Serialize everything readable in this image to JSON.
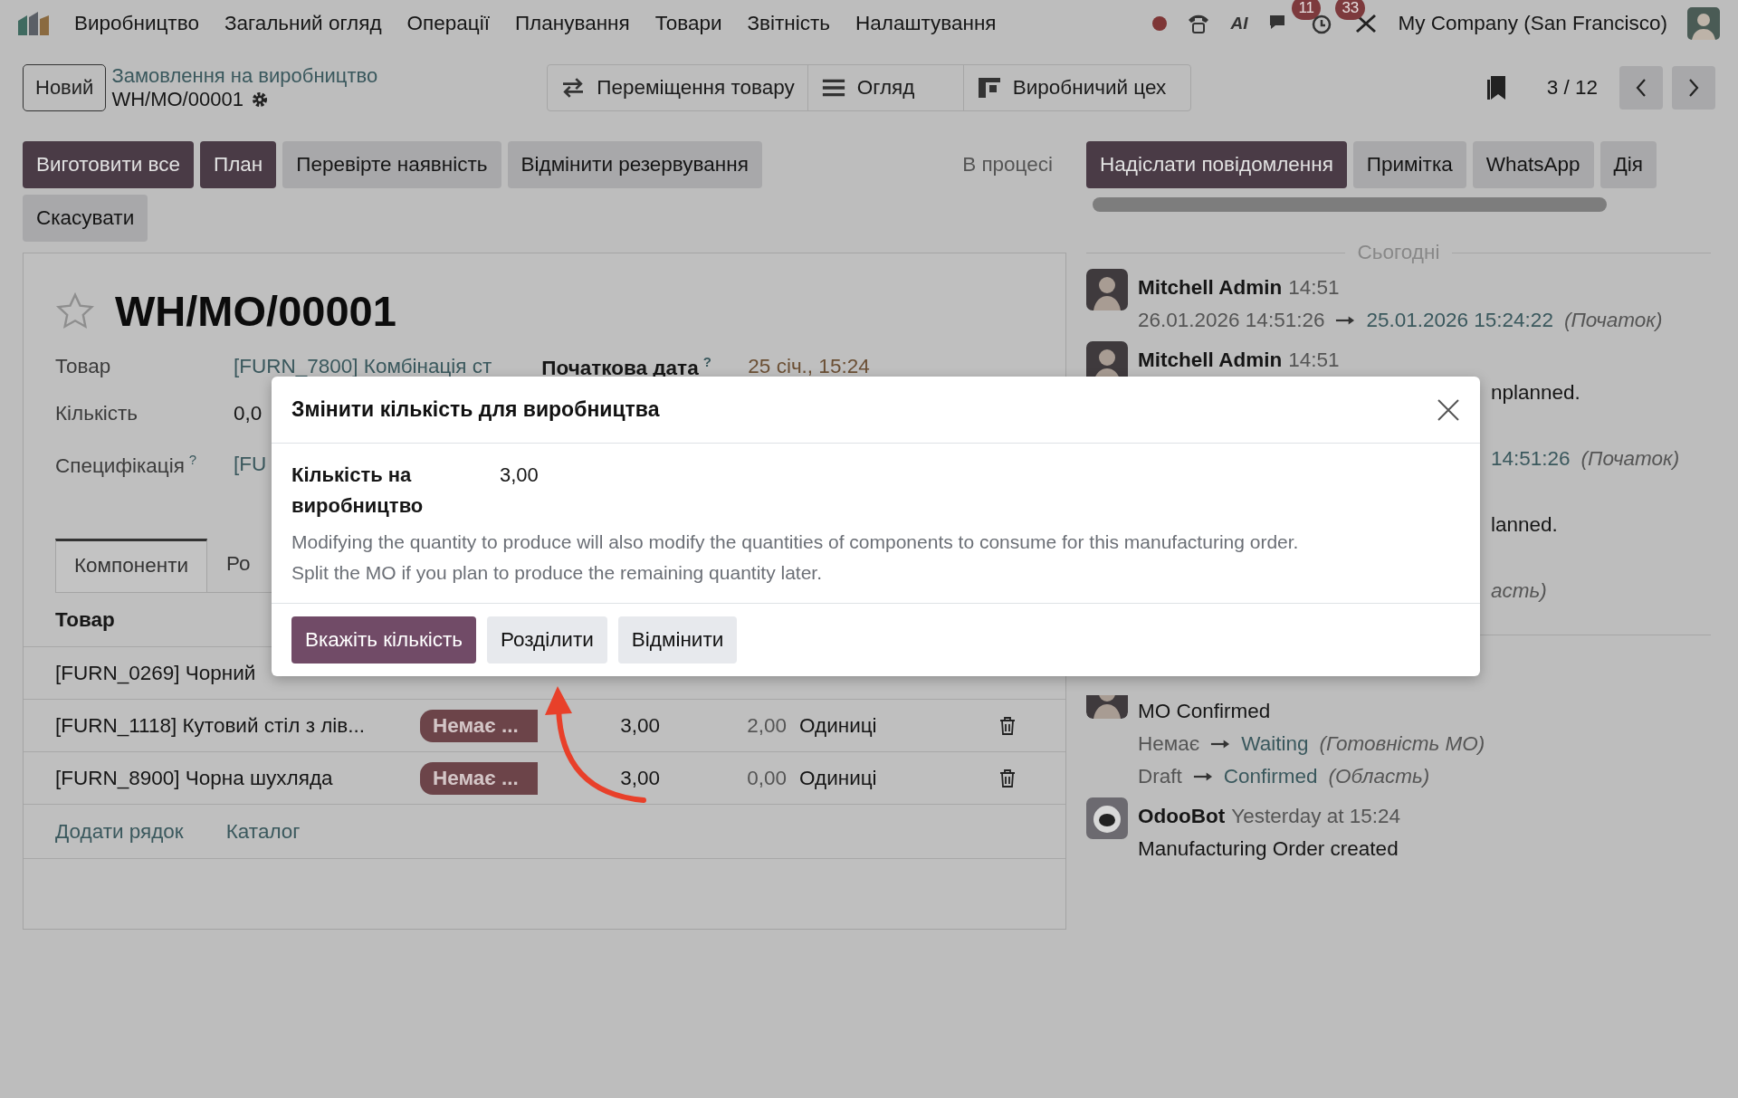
{
  "navbar": {
    "app_name": "Виробництво",
    "menu": [
      "Загальний огляд",
      "Операції",
      "Планування",
      "Товари",
      "Звітність",
      "Налаштування"
    ],
    "ai_label": "AI",
    "chat_count": "11",
    "activity_count": "33",
    "company": "My Company (San Francisco)"
  },
  "control_panel": {
    "new_button": "Новий",
    "breadcrumb": "Замовлення на виробництво",
    "record": "WH/MO/00001",
    "smart_buttons": [
      {
        "label": "Переміщення товару",
        "kind": "transfers"
      },
      {
        "label": "Огляд",
        "kind": "overview"
      },
      {
        "label": "Виробничий цех",
        "kind": "workcenter"
      }
    ],
    "pager": "3 / 12"
  },
  "actions": [
    {
      "label": "Виготовити все",
      "primary": true
    },
    {
      "label": "План",
      "primary": true
    },
    {
      "label": "Перевірте наявність",
      "primary": false
    },
    {
      "label": "Відмінити резервування",
      "primary": false
    },
    {
      "label": "Скасувати",
      "primary": false
    }
  ],
  "status": "В процесі",
  "form": {
    "starred": false,
    "title": "WH/MO/00001",
    "fields": [
      {
        "label": "Товар",
        "value": "[FURN_7800] Комбінація ст",
        "link": true,
        "side_label": "Початкова дата",
        "side_help": "?",
        "side_value": "25 січ., 15:24"
      },
      {
        "label": "Кількість",
        "value": "0,0",
        "link": false
      },
      {
        "label": "Специфікація",
        "help": "?",
        "value": "[FU",
        "link": true
      }
    ],
    "tabs": [
      {
        "label": "Компоненти",
        "selected": true
      },
      {
        "label": "Ро",
        "selected": false
      }
    ],
    "table": {
      "columns": [
        "Товар"
      ],
      "rows": [
        {
          "product": "[FURN_0269] Чорний"
        },
        {
          "product": "[FURN_1118] Кутовий стіл з лів...",
          "availability": "Немає ...",
          "to_consume": "3,00",
          "consumed": "2,00",
          "uom": "Одиниці"
        },
        {
          "product": "[FURN_8900] Чорна шухляда",
          "availability": "Немає ...",
          "to_consume": "3,00",
          "consumed": "0,00",
          "uom": "Одиниці"
        }
      ],
      "footer_links": [
        "Додати рядок",
        "Каталог"
      ]
    }
  },
  "chatter": {
    "buttons": [
      {
        "label": "Надіслати повідомлення",
        "primary": true
      },
      {
        "label": "Примітка",
        "primary": false
      },
      {
        "label": "WhatsApp",
        "primary": false
      },
      {
        "label": "Дія",
        "primary": false
      }
    ],
    "today": "Сьогодні",
    "entries": [
      {
        "kind": "author",
        "bot": false,
        "author": "Mitchell Admin",
        "time": "14:51"
      },
      {
        "kind": "change",
        "old": "26.01.2026 14:51:26",
        "new": "25.01.2026 15:24:22",
        "field": "(Початок)"
      },
      {
        "kind": "author",
        "bot": false,
        "author": "Mitchell Admin",
        "time": "14:51"
      },
      {
        "kind": "fragment",
        "text": "nplanned."
      },
      {
        "kind": "fragment_change",
        "new": "14:51:26",
        "field": "(Початок)"
      },
      {
        "kind": "fragment",
        "text": "lanned."
      },
      {
        "kind": "fragment_field",
        "field": "асть)"
      }
    ],
    "later_entries": [
      {
        "kind": "avatar",
        "bot": false
      },
      {
        "kind": "text",
        "text": "MO Confirmed"
      },
      {
        "kind": "change",
        "old": "Немає",
        "new": "Waiting",
        "field": "(Готовність МО)"
      },
      {
        "kind": "change",
        "old": "Draft",
        "new": "Confirmed",
        "field": "(Область)"
      },
      {
        "kind": "author",
        "bot": true,
        "author": "OdooBot",
        "time": "Yesterday at 15:24"
      },
      {
        "kind": "text",
        "text": "Manufacturing Order created"
      }
    ]
  },
  "dialog": {
    "title": "Змінити кількість для виробництва",
    "field_label": "Кількість на виробництво",
    "field_value": "3,00",
    "help": [
      "Modifying the quantity to produce will also modify the quantities of components to consume for this manufacturing order.",
      "Split the MO if you plan to produce the remaining quantity later."
    ],
    "buttons": [
      {
        "label": "Вкажіть кількість",
        "primary": true
      },
      {
        "label": "Розділити",
        "primary": false
      },
      {
        "label": "Відмінити",
        "primary": false
      }
    ]
  }
}
